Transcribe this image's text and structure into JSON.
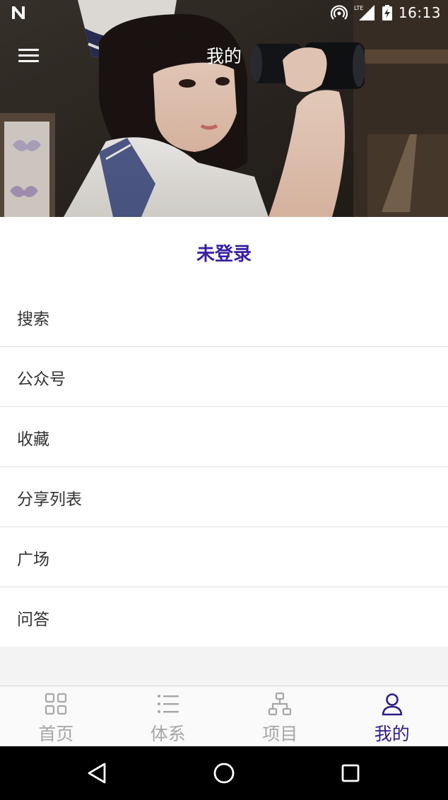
{
  "status_bar": {
    "time": "16:13",
    "network": "LTE",
    "icons": [
      "notification-n-icon",
      "hotspot-icon",
      "signal-icon",
      "battery-charging-icon"
    ]
  },
  "header": {
    "title": "我的",
    "menu_icon": "hamburger-menu-icon"
  },
  "profile": {
    "login_status": "未登录",
    "accent_color": "#3a1fa3"
  },
  "menu": {
    "items": [
      {
        "label": "搜索"
      },
      {
        "label": "公众号"
      },
      {
        "label": "收藏"
      },
      {
        "label": "分享列表"
      },
      {
        "label": "广场"
      },
      {
        "label": "问答"
      }
    ]
  },
  "bottom_nav": {
    "active_color": "#2d1d8c",
    "inactive_color": "#a6a6a6",
    "items": [
      {
        "label": "首页",
        "icon": "grid-icon",
        "active": false
      },
      {
        "label": "体系",
        "icon": "list-icon",
        "active": false
      },
      {
        "label": "项目",
        "icon": "hierarchy-icon",
        "active": false
      },
      {
        "label": "我的",
        "icon": "user-icon",
        "active": true
      }
    ]
  },
  "system_nav": {
    "icons": [
      "back-icon",
      "home-icon",
      "recents-icon"
    ]
  }
}
